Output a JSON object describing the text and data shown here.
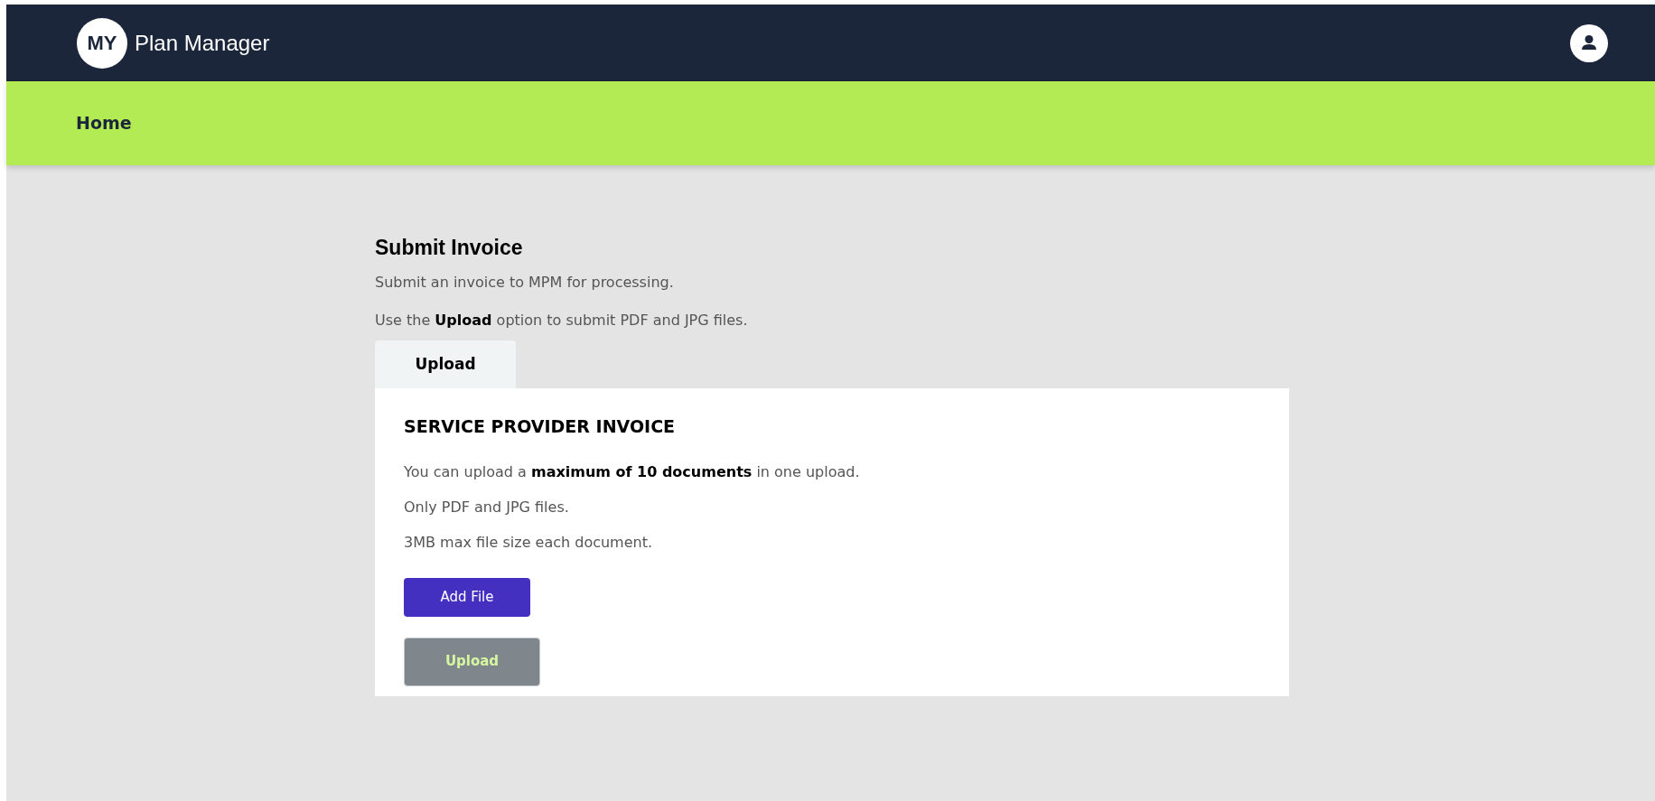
{
  "header": {
    "logo_mark": "MY",
    "brand": "Plan Manager"
  },
  "nav": {
    "items": [
      {
        "label": "Home"
      }
    ]
  },
  "page": {
    "title": "Submit Invoice",
    "intro": [
      "Submit an invoice to MPM for processing.",
      "Use the **Upload** option to submit PDF and JPG files."
    ]
  },
  "tabs": [
    {
      "label": "Upload",
      "selected": true
    }
  ],
  "card": {
    "title": "SERVICE PROVIDER INVOICE",
    "lines": [
      "You can upload a **maximum of 10 documents** in one upload.",
      "Only PDF and JPG files.",
      "3MB max file size each document."
    ],
    "buttons": [
      {
        "label": "Add File",
        "disabled": false
      },
      {
        "label": "Upload",
        "disabled": true
      }
    ]
  }
}
